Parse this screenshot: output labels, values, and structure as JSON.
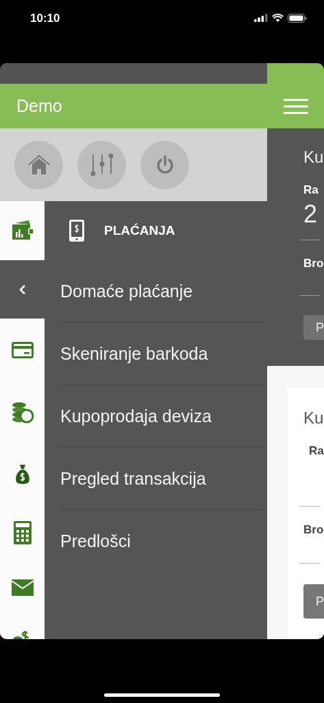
{
  "status_bar": {
    "time": "10:10"
  },
  "header": {
    "title": "Demo"
  },
  "quick_actions": [
    {
      "kind": "home"
    },
    {
      "kind": "settings"
    },
    {
      "kind": "power"
    }
  ],
  "side_icons": [
    {
      "kind": "wallet",
      "selected": false
    },
    {
      "kind": "back",
      "selected": true
    },
    {
      "kind": "card",
      "selected": false
    },
    {
      "kind": "coins",
      "selected": false
    },
    {
      "kind": "moneybag",
      "selected": false
    },
    {
      "kind": "calculator",
      "selected": false
    },
    {
      "kind": "envelope",
      "selected": false
    },
    {
      "kind": "dollar",
      "selected": false
    }
  ],
  "menu": {
    "title": "PLAĆANJA",
    "items": [
      {
        "label": "Domaće plaćanje"
      },
      {
        "label": "Skeniranje barkoda"
      },
      {
        "label": "Kupoprodaja deviza"
      },
      {
        "label": "Pregled transakcija"
      },
      {
        "label": "Predlošci"
      }
    ]
  },
  "background_cards": [
    {
      "title": "Ku",
      "field_1_label": "Ra",
      "field_1_value": "2",
      "field_2_label": "Bro",
      "button": "P"
    },
    {
      "title": "Ku",
      "field_1_label": "Ra",
      "field_2_label": "Bro",
      "button": "P"
    }
  ]
}
